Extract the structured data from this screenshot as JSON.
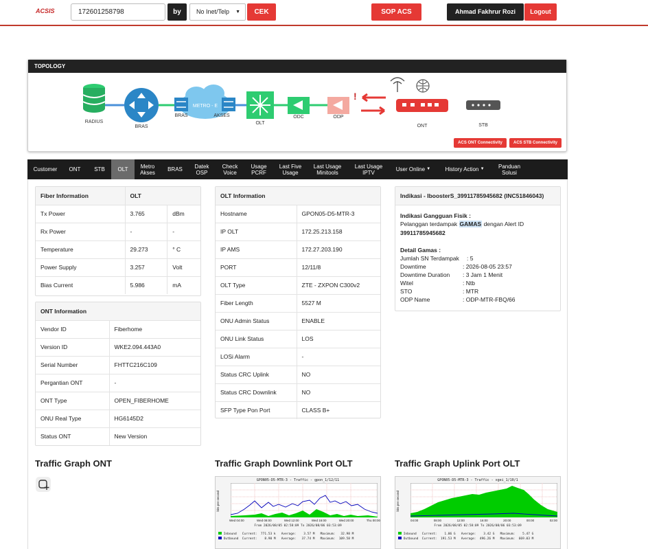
{
  "header": {
    "logo": "ACSIS",
    "search_value": "172601258798",
    "by_label": "by",
    "select_value": "No Inet/Telp",
    "check_label": "CEK",
    "sop_label": "SOP ACS",
    "user_name": "Ahmad Fakhrur Rozi",
    "logout_label": "Logout"
  },
  "topology": {
    "title": "TOPOLOGY",
    "nodes": {
      "radius": "RADIUS",
      "bras1": "BRAS",
      "bras2": "BRAS",
      "metro": "METRO - E",
      "akses": "AKSES",
      "olt": "OLT",
      "odc": "ODC",
      "odp": "ODP",
      "ont": "ONT",
      "stb": "STB"
    },
    "alarm_mark": "!",
    "acs_ont_btn": "ACS ONT Connectivity",
    "acs_stb_btn": "ACS STB Connectivity"
  },
  "nav": {
    "items": [
      "Customer",
      "ONT",
      "STB",
      "OLT",
      "Metro Akses",
      "BRAS",
      "Datek OSP",
      "Check Voice",
      "Usage PCRF",
      "Last Five Usage",
      "Last Usage Minitools",
      "Last Usage IPTV",
      "User Online",
      "History Action",
      "Panduan Solusi"
    ],
    "active": "OLT"
  },
  "fiber_info": {
    "header": [
      "Fiber Information",
      "OLT"
    ],
    "rows": [
      [
        "Tx Power",
        "3.765",
        "dBm"
      ],
      [
        "Rx Power",
        "-",
        "-"
      ],
      [
        "Temperature",
        "29.273",
        "° C"
      ],
      [
        "Power Supply",
        "3.257",
        "Volt"
      ],
      [
        "Bias Current",
        "5.986",
        "mA"
      ]
    ]
  },
  "ont_info": {
    "header": "ONT Information",
    "rows": [
      [
        "Vendor ID",
        "Fiberhome"
      ],
      [
        "Version ID",
        "WKE2.094.443A0"
      ],
      [
        "Serial Number",
        "FHTTC216C109"
      ],
      [
        "Pergantian ONT",
        "-"
      ],
      [
        "ONT Type",
        "OPEN_FIBERHOME"
      ],
      [
        "ONU Real Type",
        "HG6145D2"
      ],
      [
        "Status ONT",
        "New Version"
      ]
    ]
  },
  "olt_info": {
    "header": "OLT Information",
    "rows": [
      [
        "Hostname",
        "GPON05-D5-MTR-3"
      ],
      [
        "IP OLT",
        "172.25.213.158"
      ],
      [
        "IP AMS",
        "172.27.203.190"
      ],
      [
        "PORT",
        "12/11/8"
      ],
      [
        "OLT Type",
        "ZTE - ZXPON C300v2"
      ],
      [
        "Fiber Length",
        "5527 M"
      ],
      [
        "ONU Admin Status",
        "ENABLE"
      ],
      [
        "ONU Link Status",
        "LOS"
      ],
      [
        "LOSi Alarm",
        "-"
      ],
      [
        "Status CRC Uplink",
        "NO"
      ],
      [
        "Status CRC Downlink",
        "NO"
      ],
      [
        "SFP Type Pon Port",
        "CLASS B+"
      ]
    ]
  },
  "indikasi": {
    "title": "Indikasi - IboosterS_39911785945682 (INC51846043)",
    "gangguan_title": "Indikasi Gangguan Fisik :",
    "gangguan_pre": "Pelanggan terdampak",
    "gangguan_hl": "GAMAS",
    "gangguan_post": "dengan Alert ID",
    "alert_id": "39911785945682",
    "detail_title": "Detail Gamas :",
    "details": [
      [
        "Jumlah SN Terdampak",
        ": 5"
      ],
      [
        "Downtime",
        ": 2026-08-05 23:57"
      ],
      [
        "Downtime Duration",
        ": 3 Jam 1 Menit"
      ],
      [
        "Witel",
        ": Ntb"
      ],
      [
        "STO",
        ": MTR"
      ],
      [
        "ODP Name",
        ": ODP-MTR-FBQ/66"
      ]
    ]
  },
  "graphs": {
    "ont_title": "Traffic Graph ONT",
    "downlink_title": "Traffic Graph Downlink Port OLT",
    "uplink_title": "Traffic Graph Uplink Port OLT",
    "downlink": {
      "caption": "GPON05-D5-MTR-3 - Traffic - gpon_1/12/11",
      "range": "From 2026/08/05 02:58:09 To 2026/08/06 03:53:09",
      "inbound": "Inbound   Current:  771.53 k   Average:    3.57 M   Maximum:   32.98 M",
      "outbound": "Outbound  Current:    8.90 M   Average:   37.74 M   Maximum:  109.58 M",
      "xticks": [
        "Wed 04:00",
        "Wed 08:00",
        "Wed 12:00",
        "Wed 16:00",
        "Wed 20:00",
        "Thu 00:00"
      ],
      "ylabel": "bits per second"
    },
    "uplink": {
      "caption": "GPON05-D5-MTR-3 - Traffic - xgei_1/10/1",
      "range": "From 2026/08/05 02:58:09 To 2026/08/06 03:53:09",
      "inbound": "Inbound   Current:    1.06 G   Average:    3.42 G   Maximum:    5.47 G",
      "outbound": "Outbound  Current:  191.53 M   Average:  496.26 M   Maximum:  669.03 M",
      "xticks": [
        "04:00",
        "08:00",
        "12:00",
        "16:00",
        "20:00",
        "00:00",
        "02:00"
      ],
      "ylabel": "bits per second"
    }
  }
}
